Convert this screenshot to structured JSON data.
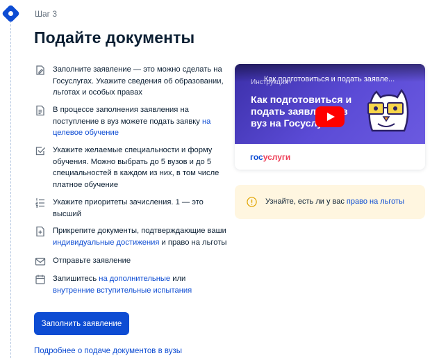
{
  "step_label": "Шаг 3",
  "title": "Подайте документы",
  "steps": [
    {
      "icon": "edit-document-icon",
      "parts": [
        {
          "text": "Заполните заявление — это можно сделать на Госуслугах. Укажите сведения об образовании, льготах и особых правах",
          "link": false
        }
      ]
    },
    {
      "icon": "document-icon",
      "parts": [
        {
          "text": "В процессе заполнения заявления на поступление в вуз можете подать заявку ",
          "link": false
        },
        {
          "text": "на целевое обучение",
          "link": true
        }
      ]
    },
    {
      "icon": "checkbox-icon",
      "parts": [
        {
          "text": "Укажите желаемые специальности и форму обучения. Можно выбрать до 5 вузов и до 5 специальностей в каждом из них, в том числе платное обучение",
          "link": false
        }
      ]
    },
    {
      "icon": "numbered-list-icon",
      "parts": [
        {
          "text": "Укажите приоритеты зачисления. 1 — это высший",
          "link": false
        }
      ]
    },
    {
      "icon": "attach-document-icon",
      "parts": [
        {
          "text": "Прикрепите документы, подтверждающие ваши ",
          "link": false
        },
        {
          "text": "индивидуальные достижения",
          "link": true
        },
        {
          "text": " и право на льготы",
          "link": false
        }
      ]
    },
    {
      "icon": "envelope-icon",
      "parts": [
        {
          "text": "Отправьте заявление",
          "link": false
        }
      ]
    },
    {
      "icon": "calendar-icon",
      "parts": [
        {
          "text": "Запишитесь ",
          "link": false
        },
        {
          "text": "на дополнительные",
          "link": true
        },
        {
          "text": " или ",
          "link": false
        },
        {
          "text": "внутренние вступительные испытания",
          "link": true
        }
      ]
    }
  ],
  "primary_button": "Заполнить заявление",
  "more_link": "Подробнее о подаче документов в вузы",
  "video": {
    "channel": "Инструкция",
    "top_title": "Как подготовиться и подать заявле...",
    "headline": "Как подготовиться и подать заявление в вуз на Госуслугах",
    "brand_gos": "гос",
    "brand_uslugi": "услуги"
  },
  "notice": {
    "text_before": "Узнайте, есть ли у вас ",
    "link": "право на льготы"
  },
  "colors": {
    "accent": "#0d4cd3",
    "notice_bg": "#fff6e0",
    "video_bg": "#4a3cc4",
    "play": "#ff0000"
  }
}
